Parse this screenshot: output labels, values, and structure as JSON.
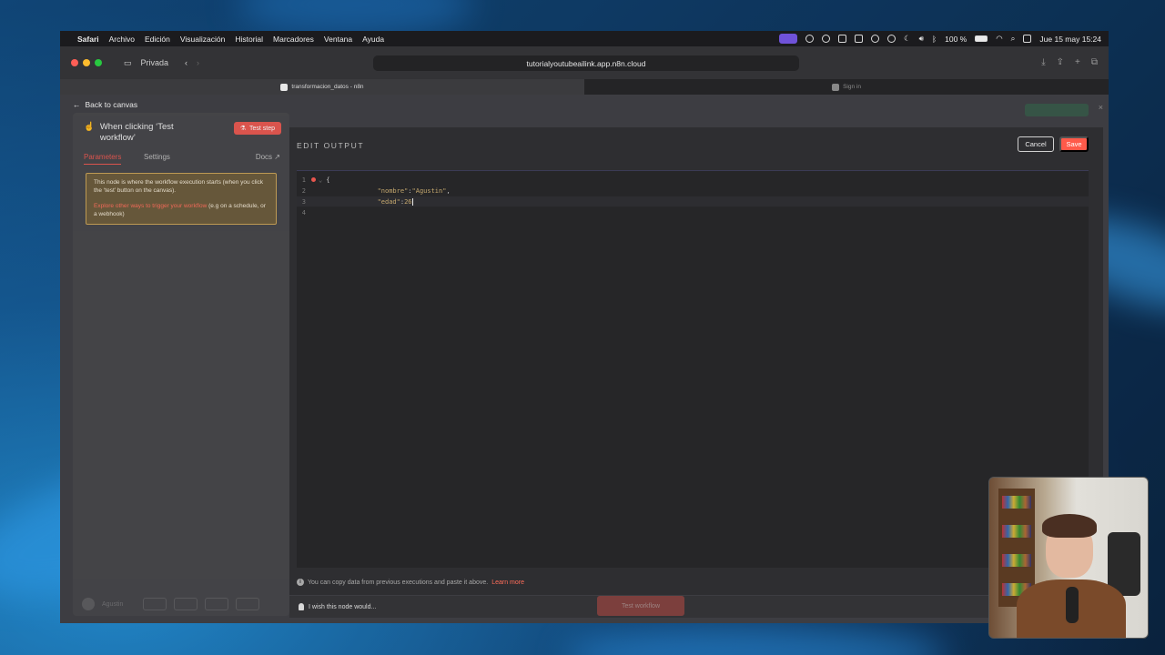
{
  "menubar": {
    "items": [
      "Safari",
      "Archivo",
      "Edición",
      "Visualización",
      "Historial",
      "Marcadores",
      "Ventana",
      "Ayuda"
    ],
    "battery": "100 %",
    "datetime": "Jue 15 may 15:24"
  },
  "browser": {
    "private_label": "Privada",
    "url": "tutorialyoutubeailink.app.n8n.cloud",
    "tabs": [
      {
        "label": "transformacion_datos - n8n"
      },
      {
        "label": "Sign in"
      }
    ]
  },
  "n8n": {
    "back_label": "Back to canvas",
    "node_title": "When clicking ‘Test workflow’",
    "test_step_label": "Test step",
    "tabs": {
      "parameters": "Parameters",
      "settings": "Settings",
      "docs": "Docs"
    },
    "notice": {
      "text": "This node is where the workflow execution starts (when you click the ‘test’ button on the canvas).",
      "link": "Explore other ways to trigger your workflow",
      "suffix": " (e.g on a schedule, or a webhook)"
    },
    "footer_label": "Agustin",
    "edit_output": {
      "title": "EDIT OUTPUT",
      "cancel_label": "Cancel",
      "save_label": "Save",
      "lines": [
        {
          "num": "1",
          "text": "{"
        },
        {
          "num": "2",
          "key": "\"nombre\"",
          "value": "\"Agustin\"",
          "suffix": ","
        },
        {
          "num": "3",
          "key": "\"edad\"",
          "value": "26",
          "suffix": ""
        },
        {
          "num": "4",
          "text": ""
        }
      ],
      "hint": "You can copy data from previous executions and paste it above.",
      "hint_link": "Learn more"
    },
    "wish_label": "I wish this node would...",
    "test_workflow_label": "Test workflow"
  }
}
